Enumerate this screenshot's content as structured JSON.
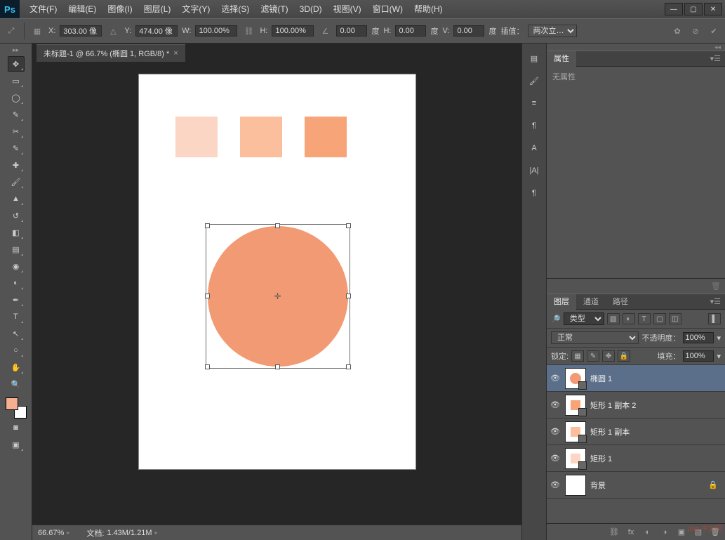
{
  "app": {
    "logo": "Ps"
  },
  "menu": [
    "文件(F)",
    "编辑(E)",
    "图像(I)",
    "图层(L)",
    "文字(Y)",
    "选择(S)",
    "滤镜(T)",
    "3D(D)",
    "视图(V)",
    "窗口(W)",
    "帮助(H)"
  ],
  "options": {
    "x_label": "X:",
    "x_val": "303.00 像",
    "y_label": "Y:",
    "y_val": "474.00 像",
    "w_label": "W:",
    "w_val": "100.00%",
    "h_label": "H:",
    "h_val": "100.00%",
    "angle_val": "0.00",
    "angle_unit": "度",
    "hskew_label": "H:",
    "hskew_val": "0.00",
    "hskew_unit": "度",
    "vskew_label": "V:",
    "vskew_val": "0.00",
    "vskew_unit": "度",
    "interp_label": "插值：",
    "interp_val": "两次立…"
  },
  "doc": {
    "tab": "未标题-1 @ 66.7% (椭圆 1, RGB/8) *"
  },
  "status": {
    "zoom": "66.67%",
    "doc_label": "文档:",
    "doc_val": "1.43M/1.21M"
  },
  "panels": {
    "properties": {
      "tab": "属性",
      "empty": "无属性"
    },
    "layers": {
      "tabs": [
        "图层",
        "通道",
        "路径"
      ],
      "filter_label": "类型",
      "blend": "正常",
      "opacity_label": "不透明度：",
      "opacity_val": "100%",
      "lock_label": "锁定:",
      "fill_label": "填充：",
      "fill_val": "100%",
      "items": [
        {
          "name": "椭圆 1",
          "thumb": "circ",
          "sel": true
        },
        {
          "name": "矩形 1 副本 2",
          "thumb": "sq1"
        },
        {
          "name": "矩形 1 副本",
          "thumb": "sq2"
        },
        {
          "name": "矩形 1",
          "thumb": "sq3"
        },
        {
          "name": "背景",
          "thumb": "bg",
          "locked": true
        }
      ]
    }
  },
  "colors": {
    "fg": "#f4b091",
    "bg": "#ffffff",
    "circle": "#f29a73"
  },
  "watermark": "php 中文网"
}
